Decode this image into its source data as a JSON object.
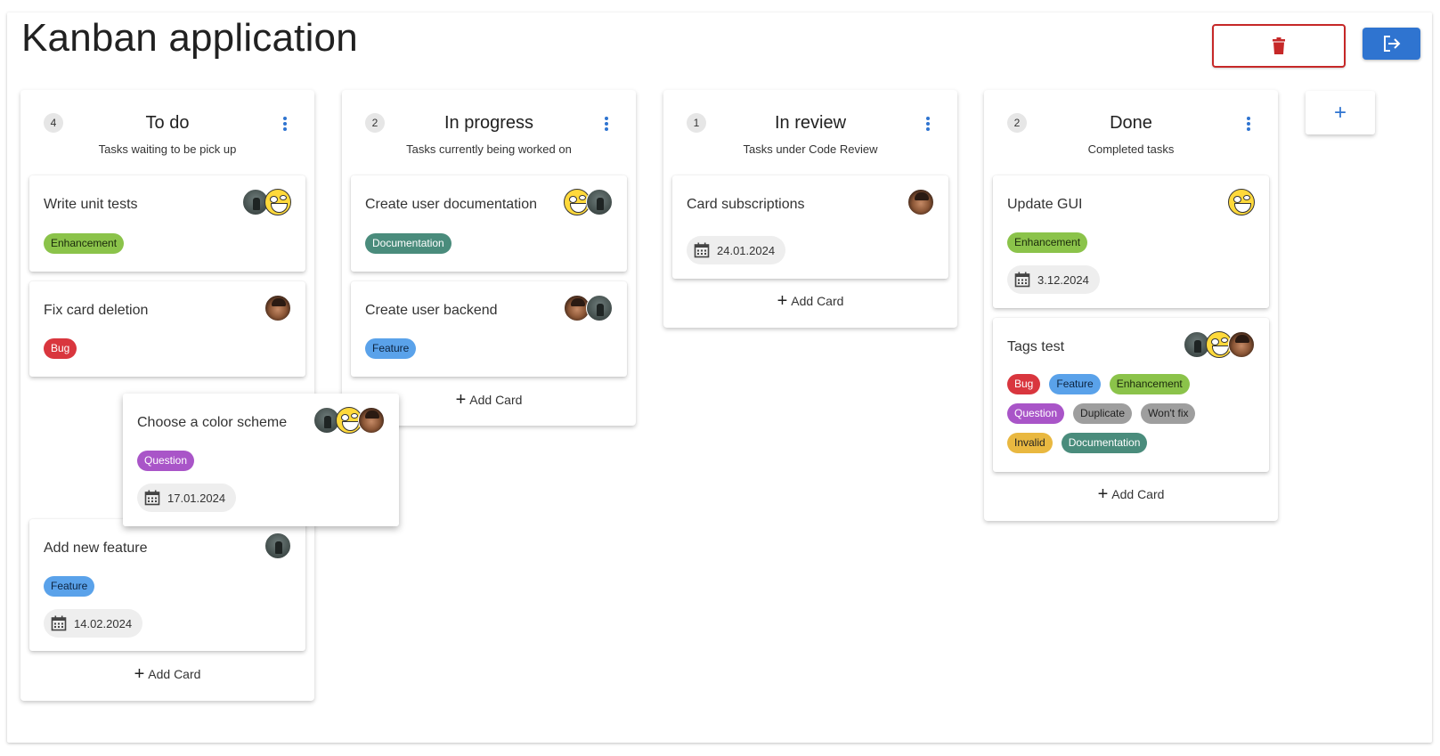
{
  "app": {
    "title": "Kanban application"
  },
  "icons": {
    "delete": "trash-icon",
    "logout": "logout-icon",
    "add_column": "plus-icon",
    "menu": "vertical-dots-icon",
    "date": "calendar-icon"
  },
  "colors": {
    "accent": "#2f74d0",
    "danger": "#c62828"
  },
  "add_card_label": "Add Card",
  "add_column_label": "+",
  "columns": [
    {
      "count": "4",
      "title": "To do",
      "subtitle": "Tasks waiting to be pick up",
      "cards": [
        {
          "title": "Write unit tests",
          "avatars": [
            "dark",
            "troll"
          ],
          "tags": [
            {
              "label": "Enhancement",
              "color": "#8bc34a"
            }
          ]
        },
        {
          "title": "Fix card deletion",
          "avatars": [
            "man"
          ],
          "tags": [
            {
              "label": "Bug",
              "color": "#d9363e"
            }
          ]
        },
        {
          "title": "Add new feature",
          "avatars": [
            "dark"
          ],
          "tags": [
            {
              "label": "Feature",
              "color": "#5aa2ea"
            }
          ],
          "date": "14.02.2024"
        }
      ]
    },
    {
      "count": "2",
      "title": "In progress",
      "subtitle": "Tasks currently being worked on",
      "cards": [
        {
          "title": "Create user documentation",
          "avatars": [
            "troll",
            "dark"
          ],
          "tags": [
            {
              "label": "Documentation",
              "color": "#4a8c7c"
            }
          ]
        },
        {
          "title": "Create user backend",
          "avatars": [
            "man",
            "dark"
          ],
          "tags": [
            {
              "label": "Feature",
              "color": "#5aa2ea"
            }
          ]
        }
      ]
    },
    {
      "count": "1",
      "title": "In review",
      "subtitle": "Tasks under Code Review",
      "cards": [
        {
          "title": "Card subscriptions",
          "avatars": [
            "man"
          ],
          "date": "24.01.2024"
        }
      ]
    },
    {
      "count": "2",
      "title": "Done",
      "subtitle": "Completed tasks",
      "cards": [
        {
          "title": "Update GUI",
          "avatars": [
            "troll"
          ],
          "tags": [
            {
              "label": "Enhancement",
              "color": "#8bc34a"
            }
          ],
          "date": "3.12.2024"
        },
        {
          "title": "Tags test",
          "avatars": [
            "dark",
            "troll",
            "man"
          ],
          "tags": [
            {
              "label": "Bug",
              "color": "#d9363e"
            },
            {
              "label": "Feature",
              "color": "#5aa2ea"
            },
            {
              "label": "Enhancement",
              "color": "#8bc34a"
            },
            {
              "label": "Question",
              "color": "#a955c8"
            },
            {
              "label": "Duplicate",
              "color": "#9e9e9e"
            },
            {
              "label": "Won't fix",
              "color": "#9e9e9e"
            },
            {
              "label": "Invalid",
              "color": "#e9b840"
            },
            {
              "label": "Documentation",
              "color": "#4a8c7c"
            }
          ]
        }
      ]
    }
  ],
  "dragging_card": {
    "title": "Choose a color scheme",
    "avatars": [
      "dark",
      "troll",
      "man"
    ],
    "tags": [
      {
        "label": "Question",
        "color": "#a955c8"
      }
    ],
    "date": "17.01.2024"
  }
}
